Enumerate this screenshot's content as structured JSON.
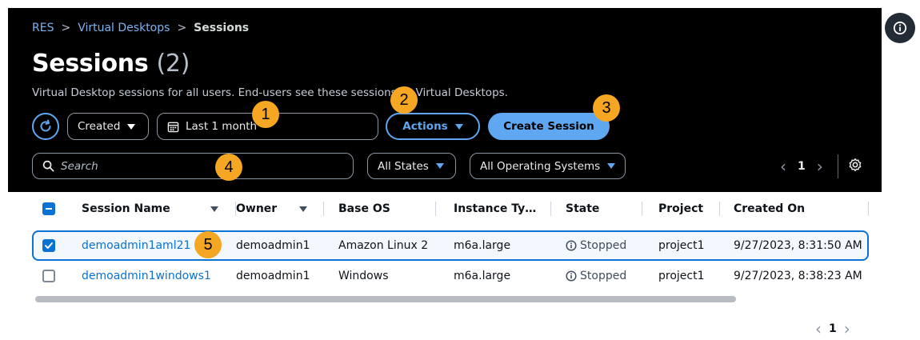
{
  "breadcrumb": {
    "items": [
      "RES",
      "Virtual Desktops",
      "Sessions"
    ]
  },
  "header": {
    "title": "Sessions",
    "count": "(2)",
    "description": "Virtual Desktop sessions for all users. End-users see these sessions as Virtual Desktops."
  },
  "toolbar": {
    "created_dropdown": "Created",
    "date_range": "Last 1 month",
    "actions_label": "Actions",
    "create_label": "Create Session"
  },
  "filters": {
    "search_placeholder": "Search",
    "states": "All States",
    "os": "All Operating Systems"
  },
  "pagination": {
    "page": "1"
  },
  "badges": [
    "1",
    "2",
    "3",
    "4",
    "5"
  ],
  "table": {
    "columns": [
      "Session Name",
      "Owner",
      "Base OS",
      "Instance Ty…",
      "State",
      "Project",
      "Created On"
    ],
    "rows": [
      {
        "name": "demoadmin1aml21",
        "owner": "demoadmin1",
        "os": "Amazon Linux 2",
        "instance": "m6a.large",
        "state": "Stopped",
        "project": "project1",
        "created": "9/27/2023, 8:31:50 AM"
      },
      {
        "name": "demoadmin1windows1",
        "owner": "demoadmin1",
        "os": "Windows",
        "instance": "m6a.large",
        "state": "Stopped",
        "project": "project1",
        "created": "9/27/2023, 8:38:23 AM"
      }
    ]
  },
  "colors": {
    "accent": "#5fa7f0",
    "link": "#0972d3",
    "badge": "#f5a623",
    "header_bg": "#000000"
  }
}
